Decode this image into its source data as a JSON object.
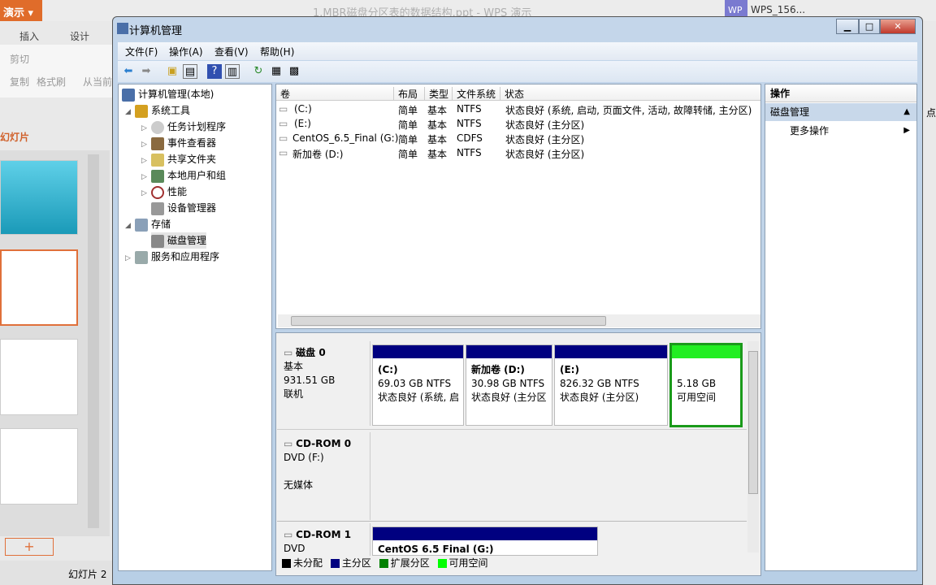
{
  "wps": {
    "app_button": "演示",
    "doc_title": "1.MBR磁盘分区表的数据结构.ppt - WPS 演示",
    "account_badge": "WP",
    "account_name": "WPS_156...",
    "tabs": [
      "插入",
      "设计"
    ],
    "ribbon": {
      "cut": "剪切",
      "copy": "复制",
      "format_painter": "格式刷",
      "from_current": "从当前"
    },
    "slides_tab": "幻灯片",
    "status": "幻灯片 2",
    "right_edge": "点"
  },
  "window": {
    "title": "计算机管理",
    "menu": [
      "文件(F)",
      "操作(A)",
      "查看(V)",
      "帮助(H)"
    ]
  },
  "tree": {
    "root": "计算机管理(本地)",
    "system_tools": "系统工具",
    "task_scheduler": "任务计划程序",
    "event_viewer": "事件查看器",
    "shared_folders": "共享文件夹",
    "local_users": "本地用户和组",
    "performance": "性能",
    "device_manager": "设备管理器",
    "storage": "存储",
    "disk_management": "磁盘管理",
    "services": "服务和应用程序"
  },
  "volumes": {
    "headers": [
      "卷",
      "布局",
      "类型",
      "文件系统",
      "状态"
    ],
    "rows": [
      {
        "name": "(C:)",
        "layout": "简单",
        "type": "基本",
        "fs": "NTFS",
        "status": "状态良好 (系统, 启动, 页面文件, 活动, 故障转储, 主分区)"
      },
      {
        "name": "(E:)",
        "layout": "简单",
        "type": "基本",
        "fs": "NTFS",
        "status": "状态良好 (主分区)"
      },
      {
        "name": "CentOS_6.5_Final (G:)",
        "layout": "简单",
        "type": "基本",
        "fs": "CDFS",
        "status": "状态良好 (主分区)"
      },
      {
        "name": "新加卷 (D:)",
        "layout": "简单",
        "type": "基本",
        "fs": "NTFS",
        "status": "状态良好 (主分区)"
      }
    ]
  },
  "disks": [
    {
      "name": "磁盘 0",
      "type": "基本",
      "size": "931.51 GB",
      "state": "联机",
      "partitions": [
        {
          "name": "(C:)",
          "size": "69.03 GB NTFS",
          "status": "状态良好 (系统, 启"
        },
        {
          "name": "新加卷  (D:)",
          "size": "30.98 GB NTFS",
          "status": "状态良好 (主分区"
        },
        {
          "name": "(E:)",
          "size": "826.32 GB NTFS",
          "status": "状态良好 (主分区)"
        },
        {
          "name": "",
          "size": "5.18 GB",
          "status": "可用空间"
        }
      ]
    },
    {
      "name": "CD-ROM 0",
      "type": "DVD (F:)",
      "state": "无媒体"
    },
    {
      "name": "CD-ROM 1",
      "type": "DVD",
      "partition": "CentOS 6.5 Final  (G:)"
    }
  ],
  "legend": [
    {
      "label": "未分配",
      "color": "#000000"
    },
    {
      "label": "主分区",
      "color": "#000080"
    },
    {
      "label": "扩展分区",
      "color": "#008000"
    },
    {
      "label": "可用空间",
      "color": "#00ff00"
    }
  ],
  "actions": {
    "title": "操作",
    "section": "磁盘管理",
    "more": "更多操作"
  }
}
